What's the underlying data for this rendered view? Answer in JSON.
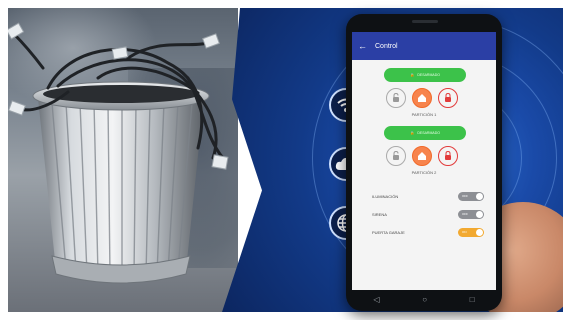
{
  "app": {
    "title": "Control",
    "back_icon": "back-arrow-icon"
  },
  "partitions": [
    {
      "arm_label": "DESARMADO",
      "name": "PARTICIÓN 1",
      "locks": [
        "unlock-grey",
        "home-orange",
        "lock-red"
      ]
    },
    {
      "arm_label": "DESARMADO",
      "name": "PARTICIÓN 2",
      "locks": [
        "unlock-grey",
        "home-orange",
        "lock-red"
      ]
    }
  ],
  "toggles": [
    {
      "label": "ILUMINACIÓN",
      "state": "OFF"
    },
    {
      "label": "SIRENA",
      "state": "OFF"
    },
    {
      "label": "PUERTA GARAJE",
      "state": "ON"
    }
  ],
  "feature_icons": [
    "wifi-icon",
    "cloud-icon",
    "globe-icon"
  ],
  "nav_icons": [
    "back-triangle-icon",
    "home-circle-icon",
    "recents-square-icon"
  ],
  "colors": {
    "app_bar": "#2b3fa5",
    "arm_button": "#3cc24a",
    "background_blue": "#1a4aa8",
    "accent_orange": "#f7844d",
    "danger_red": "#e23b3b"
  }
}
